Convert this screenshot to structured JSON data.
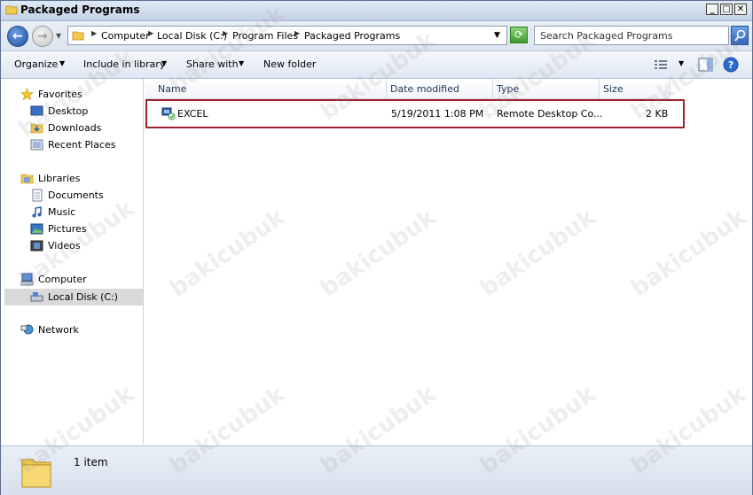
{
  "window": {
    "title": "Packaged Programs"
  },
  "address": {
    "crumbs": [
      "Computer",
      "Local Disk (C:)",
      "Program Files",
      "Packaged Programs"
    ]
  },
  "search": {
    "placeholder": "Search Packaged Programs"
  },
  "toolbar": {
    "organize": "Organize",
    "include_in_library": "Include in library",
    "share_with": "Share with",
    "new_folder": "New folder"
  },
  "nav": {
    "favorites": "Favorites",
    "desktop": "Desktop",
    "downloads": "Downloads",
    "recent_places": "Recent Places",
    "libraries": "Libraries",
    "documents": "Documents",
    "music": "Music",
    "pictures": "Pictures",
    "videos": "Videos",
    "computer": "Computer",
    "local_disk": "Local Disk (C:)",
    "network": "Network"
  },
  "columns": {
    "name": "Name",
    "date_modified": "Date modified",
    "type": "Type",
    "size": "Size"
  },
  "files": [
    {
      "name": "EXCEL",
      "date_modified": "5/19/2011 1:08 PM",
      "type": "Remote Desktop Co...",
      "size": "2 KB"
    }
  ],
  "status": {
    "count": "1 item"
  },
  "watermark": "bakicubuk",
  "colors": {
    "highlight_box": "#a2212b"
  }
}
